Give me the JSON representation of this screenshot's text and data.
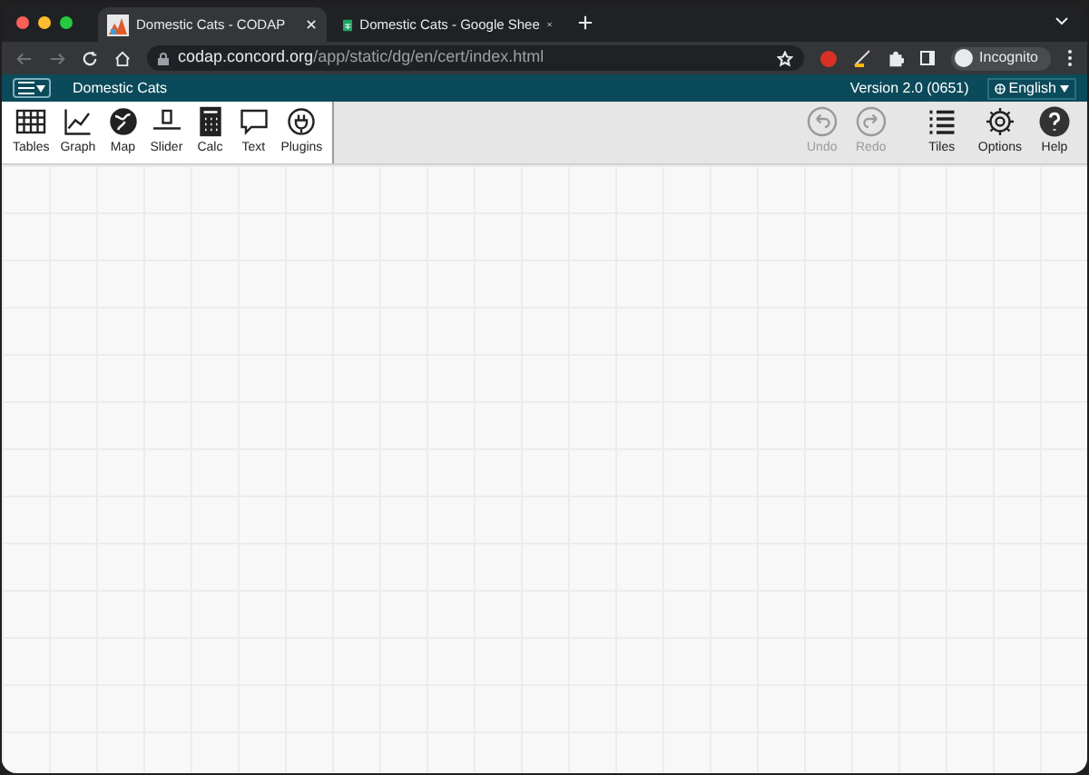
{
  "browser": {
    "tabs": [
      {
        "title": "Domestic Cats - CODAP",
        "selected": true,
        "kind": "codap"
      },
      {
        "title": "Domestic Cats - Google Shee",
        "selected": false,
        "kind": "sheets"
      }
    ],
    "url": {
      "host": "codap.concord.org",
      "path": "/app/static/dg/en/cert/index.html"
    },
    "profile": "Incognito"
  },
  "app": {
    "document_title": "Domestic Cats",
    "version": "Version 2.0 (0651)",
    "language": "English",
    "tools": [
      {
        "label": "Tables",
        "kind": "table"
      },
      {
        "label": "Graph",
        "kind": "graph"
      },
      {
        "label": "Map",
        "kind": "map"
      },
      {
        "label": "Slider",
        "kind": "slider"
      },
      {
        "label": "Calc",
        "kind": "calc"
      },
      {
        "label": "Text",
        "kind": "text"
      },
      {
        "label": "Plugins",
        "kind": "plugin"
      }
    ],
    "right_tools": [
      {
        "label": "Undo",
        "kind": "undo",
        "disabled": true
      },
      {
        "label": "Redo",
        "kind": "redo",
        "disabled": true
      },
      {
        "label": "Tiles",
        "kind": "tiles",
        "disabled": false
      },
      {
        "label": "Options",
        "kind": "options",
        "disabled": false
      },
      {
        "label": "Help",
        "kind": "help",
        "disabled": false
      }
    ]
  }
}
